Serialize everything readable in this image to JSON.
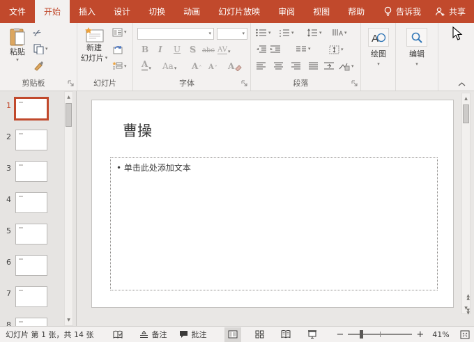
{
  "colors": {
    "accent": "#C1492C",
    "ribbon_bg": "#F3F1F0",
    "canvas_bg": "#E9E7E5",
    "status_bg": "#F3F1F0"
  },
  "icons": {
    "caret_down": "▾",
    "cut": "✂",
    "scroll_up": "▲",
    "scroll_down": "▼",
    "caret_up_small": "˄",
    "caret_down_small": "˅"
  },
  "menubar": {
    "tabs": [
      {
        "label": "文件"
      },
      {
        "label": "开始",
        "active": true
      },
      {
        "label": "插入"
      },
      {
        "label": "设计"
      },
      {
        "label": "切换"
      },
      {
        "label": "动画"
      },
      {
        "label": "幻灯片放映"
      },
      {
        "label": "审阅"
      },
      {
        "label": "视图"
      },
      {
        "label": "帮助"
      }
    ],
    "tell_me": "告诉我",
    "share": "共享"
  },
  "ribbon": {
    "clipboard": {
      "paste": "粘贴",
      "group_label": "剪贴板"
    },
    "slides": {
      "new_slide_line1": "新建",
      "new_slide_line2": "幻灯片",
      "group_label": "幻灯片"
    },
    "font": {
      "bold": "B",
      "italic": "I",
      "underline": "U",
      "shadow": "S",
      "strike": "abc",
      "spacing": "AV",
      "color": "A",
      "case": "Aa",
      "grow": "A",
      "shrink": "A",
      "clear": "A",
      "group_label": "字体"
    },
    "paragraph": {
      "group_label": "段落"
    },
    "drawing_label": "绘图",
    "editing_label": "编辑"
  },
  "slide_panel": {
    "slides": [
      {
        "num": "1",
        "selected": true
      },
      {
        "num": "2"
      },
      {
        "num": "3"
      },
      {
        "num": "4"
      },
      {
        "num": "5"
      },
      {
        "num": "6"
      },
      {
        "num": "7"
      },
      {
        "num": "8"
      }
    ]
  },
  "slide": {
    "title": "曹操",
    "bullet": "•",
    "body_placeholder": "单击此处添加文本"
  },
  "statusbar": {
    "slide_info": "幻灯片 第 1 张，共 14 张",
    "notes": "备注",
    "comments": "批注",
    "zoom_out": "−",
    "zoom_in": "+",
    "zoom_level": "41%"
  }
}
